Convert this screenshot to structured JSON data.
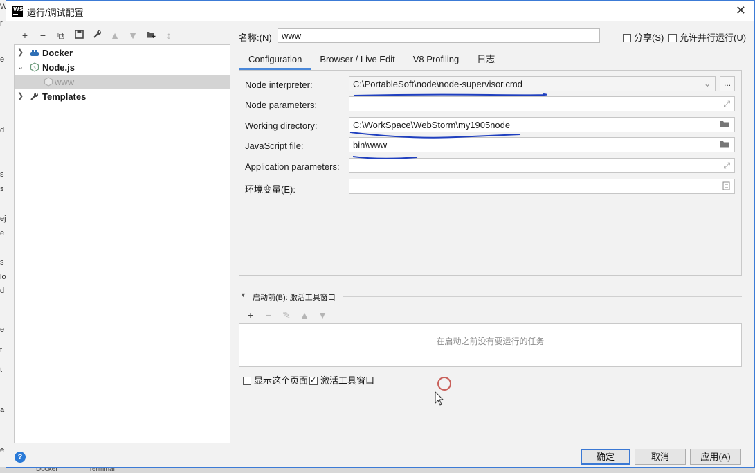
{
  "window": {
    "title": "运行/调试配置",
    "logo_text": "WS"
  },
  "background": {
    "edge_letters": [
      "W",
      "r",
      "e",
      "d",
      "s",
      "s",
      "ej",
      "e",
      "s",
      "lo",
      "d",
      "e",
      "t",
      "t",
      "a",
      "e"
    ],
    "taskbar_items": [
      "Docker",
      "Terminal"
    ]
  },
  "toolbar": [
    "+",
    "−",
    "⧉",
    "💾",
    "🔧",
    "▲",
    "▼",
    "📁",
    "↕"
  ],
  "tree": {
    "docker": "Docker",
    "nodejs": "Node.js",
    "www": "www",
    "templates": "Templates"
  },
  "config": {
    "name_label": "名称:(N)",
    "name_value": "www",
    "share_label": "分享(S)",
    "parallel_label": "允许并行运行(U)"
  },
  "tabs": [
    "Configuration",
    "Browser / Live Edit",
    "V8 Profiling",
    "日志"
  ],
  "fields": {
    "interpreter_label": "Node interpreter:",
    "interpreter_value": "C:\\PortableSoft\\node\\node-supervisor.cmd",
    "params_label": "Node parameters:",
    "params_value": "",
    "workdir_label": "Working directory:",
    "workdir_value": "C:\\WorkSpace\\WebStorm\\my1905node",
    "jsfile_label": "JavaScript file:",
    "jsfile_value": "bin\\www",
    "appparams_label": "Application parameters:",
    "appparams_value": "",
    "env_label": "环境变量(E):",
    "env_value": "",
    "browse_label": "..."
  },
  "before_launch": {
    "header": "启动前(B): 激活工具窗口",
    "empty_text": "在启动之前没有要运行的任务"
  },
  "options": {
    "show_page": "显示这个页面",
    "show_page_checked": false,
    "activate_tool": "激活工具窗口",
    "activate_tool_checked": true
  },
  "buttons": {
    "ok": "确定",
    "cancel": "取消",
    "apply": "应用(A)"
  },
  "help": "?",
  "colors": {
    "accent": "#4a88d9",
    "ink": "#1f3fbf"
  }
}
